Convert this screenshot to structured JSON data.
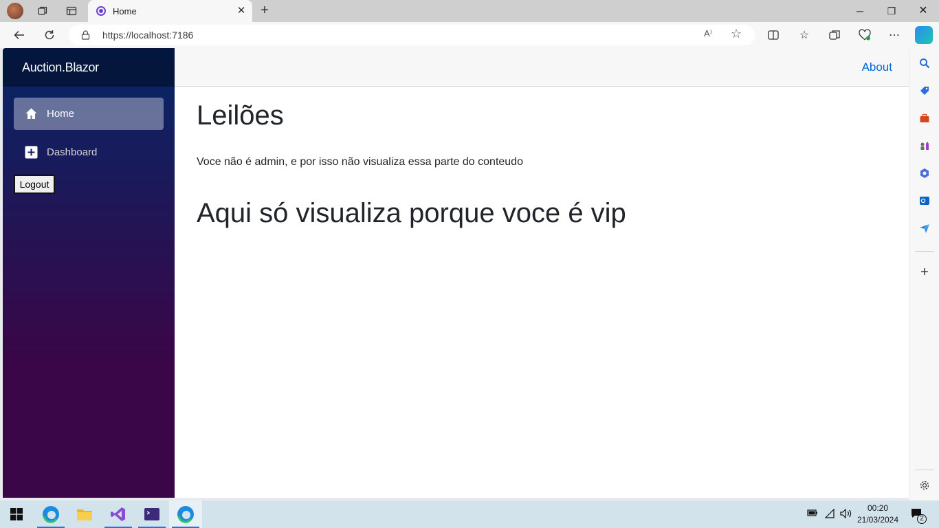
{
  "browser": {
    "tab_title": "Home",
    "url": "https://localhost:7186",
    "read_aloud": "A⁾"
  },
  "app": {
    "brand": "Auction.Blazor",
    "nav": [
      {
        "label": "Home",
        "icon": "home-icon",
        "active": true
      },
      {
        "label": "Dashboard",
        "icon": "plus-icon",
        "active": false
      }
    ],
    "logout_label": "Logout",
    "top_link": "About"
  },
  "main": {
    "heading": "Leilões",
    "message": "Voce não é admin, e por isso não visualiza essa parte do conteudo",
    "vip_heading": "Aqui só visualiza porque voce é vip"
  },
  "taskbar": {
    "time": "00:20",
    "date": "21/03/2024",
    "notification_count": "2"
  },
  "colors": {
    "sidebar_top": "#052767",
    "sidebar_bottom": "#3a0647",
    "link": "#0366d6",
    "taskbar": "#d3e3ec"
  }
}
